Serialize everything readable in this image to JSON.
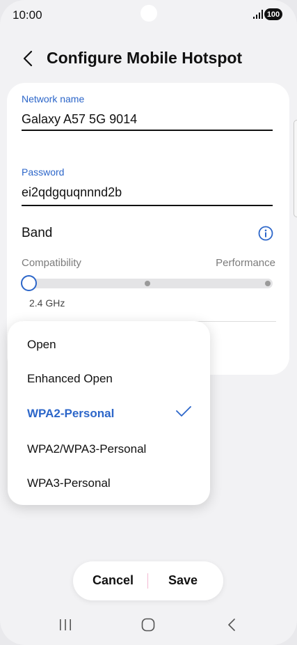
{
  "status_bar": {
    "time": "10:00",
    "battery": "100"
  },
  "header": {
    "title": "Configure Mobile Hotspot"
  },
  "network_name": {
    "label": "Network name",
    "value": "Galaxy A57 5G 9014"
  },
  "password": {
    "label": "Password",
    "value": "ei2qdgquqnnnd2b"
  },
  "band": {
    "label": "Band",
    "scale_left": "Compatibility",
    "scale_right": "Performance",
    "selected_value": "2.4 GHz",
    "slider_position": 0
  },
  "security_menu": {
    "options": [
      "Open",
      "Enhanced Open",
      "WPA2-Personal",
      "WPA2/WPA3-Personal",
      "WPA3-Personal"
    ],
    "selected": "WPA2-Personal"
  },
  "actions": {
    "cancel": "Cancel",
    "save": "Save"
  },
  "colors": {
    "accent": "#2c66c9",
    "background": "#f2f2f4",
    "card": "#ffffff"
  },
  "icons": {
    "back": "chevron-left-icon",
    "info": "info-icon",
    "check": "check-icon",
    "nav_recent": "recent-apps-icon",
    "nav_home": "home-icon",
    "nav_back": "back-icon"
  }
}
